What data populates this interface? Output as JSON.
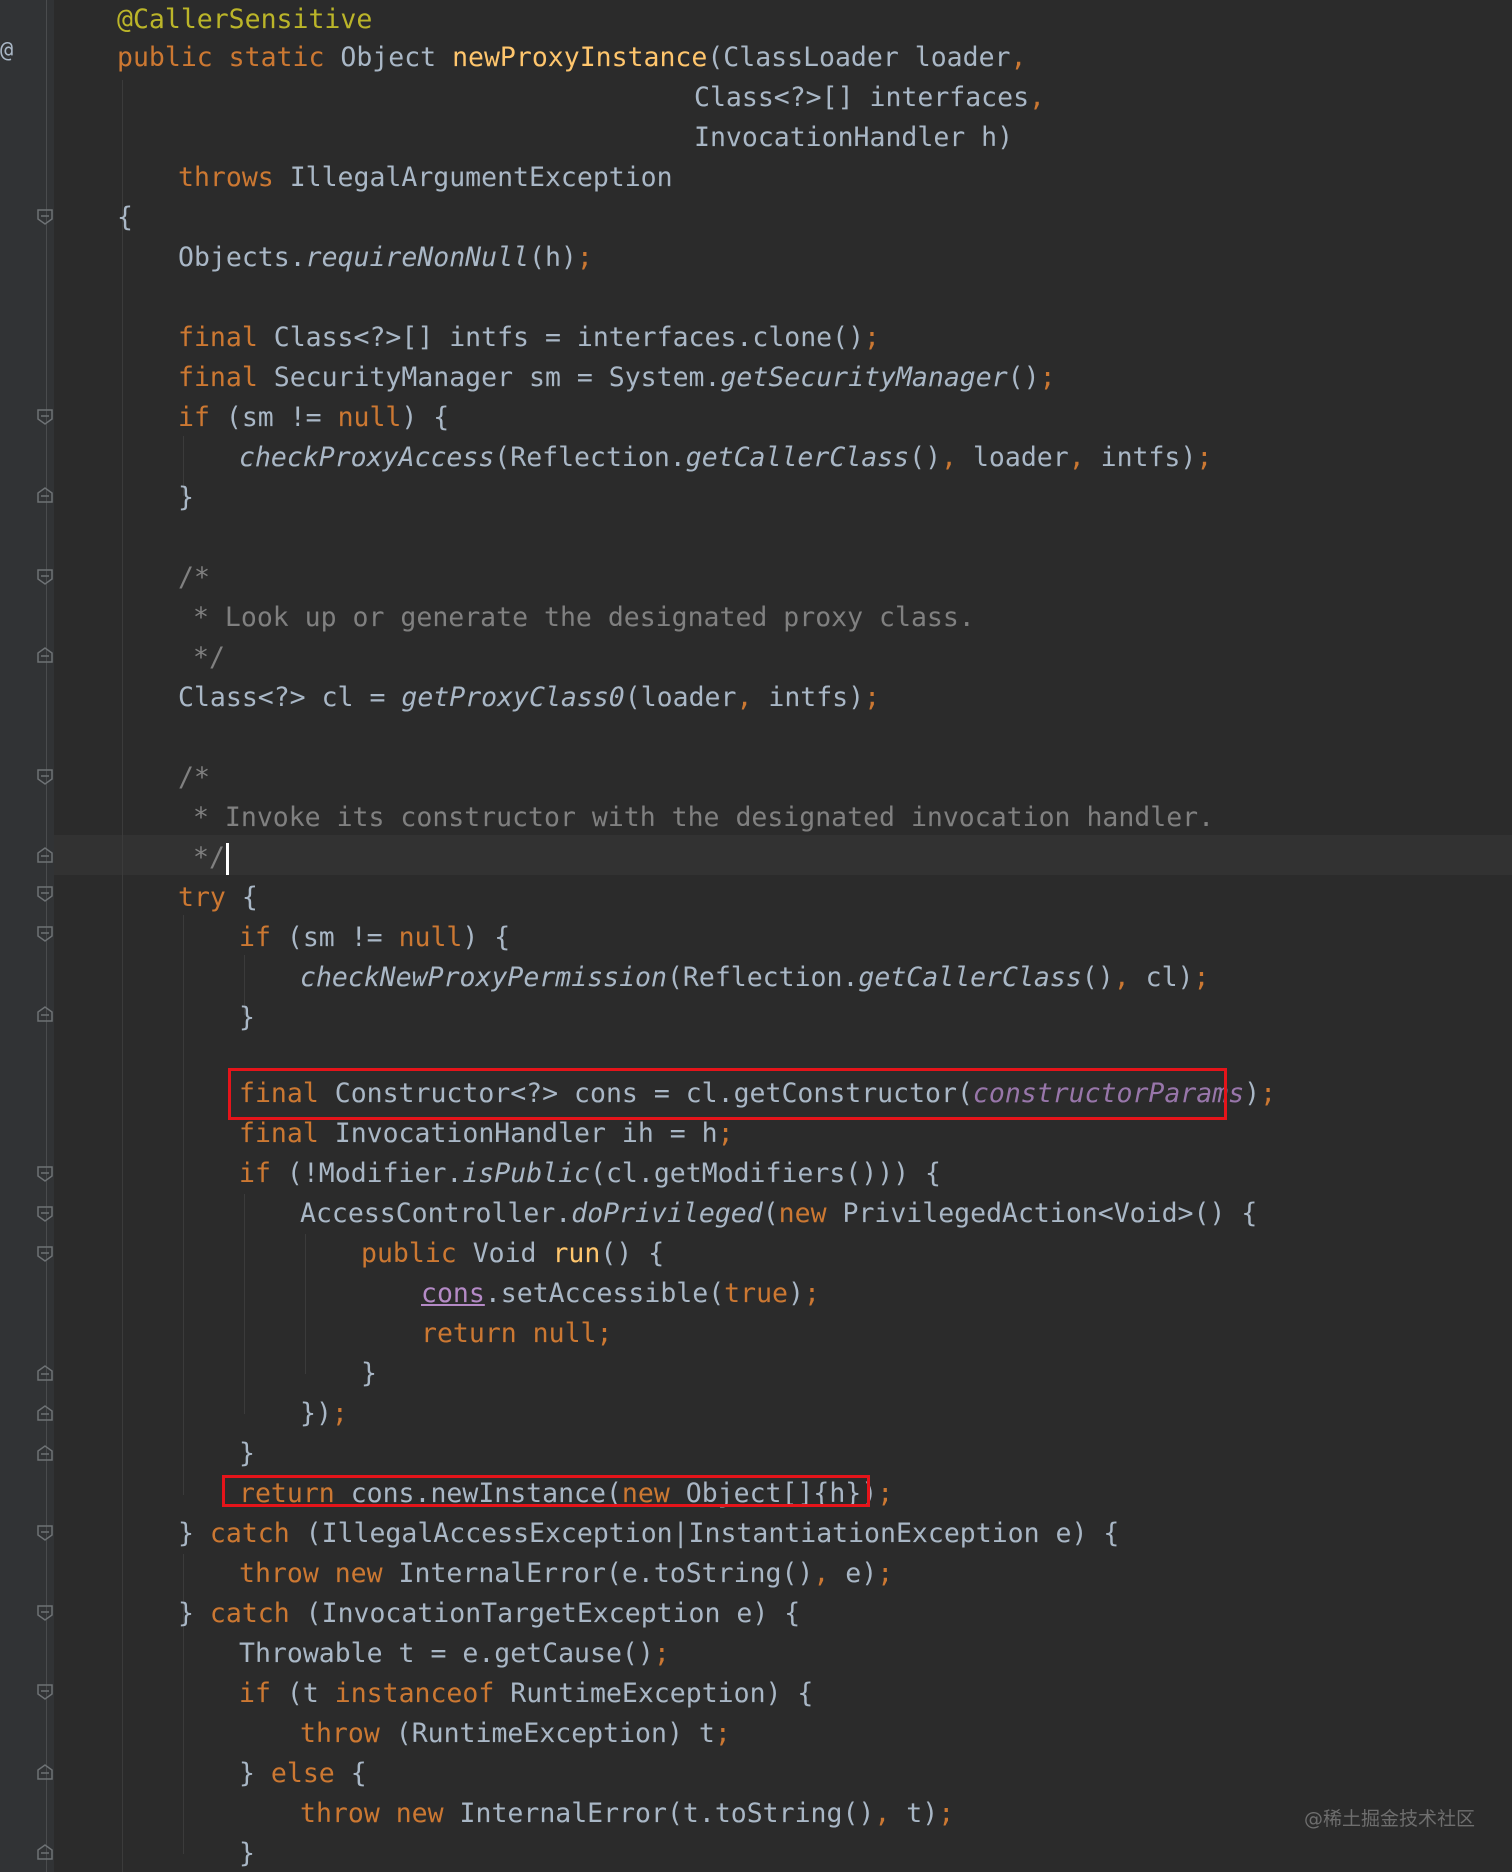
{
  "gutter": {
    "marker": "@"
  },
  "code": {
    "lines": [
      "@CallerSensitive",
      "public static Object newProxyInstance(ClassLoader loader,",
      "Class<?>[] interfaces,",
      "InvocationHandler h)",
      "throws IllegalArgumentException",
      "{",
      "Objects.requireNonNull(h);",
      "final Class<?>[] intfs = interfaces.clone();",
      "final SecurityManager sm = System.getSecurityManager();",
      "if (sm != null) {",
      "checkProxyAccess(Reflection.getCallerClass(), loader, intfs);",
      "}",
      "/*",
      "* Look up or generate the designated proxy class.",
      "*/",
      "Class<?> cl = getProxyClass0(loader, intfs);",
      "/*",
      "* Invoke its constructor with the designated invocation handler.",
      "*/",
      "try {",
      "if (sm != null) {",
      "checkNewProxyPermission(Reflection.getCallerClass(), cl);",
      "}",
      "final Constructor<?> cons = cl.getConstructor(constructorParams);",
      "final InvocationHandler ih = h;",
      "if (!Modifier.isPublic(cl.getModifiers())) {",
      "AccessController.doPrivileged(new PrivilegedAction<Void>() {",
      "public Void run() {",
      "cons.setAccessible(true);",
      "return null;",
      "}",
      "});",
      "}",
      "return cons.newInstance(new Object[]{h});",
      "} catch (IllegalAccessException|InstantiationException e) {",
      "throw new InternalError(e.toString(), e);",
      "} catch (InvocationTargetException e) {",
      "Throwable t = e.getCause();",
      "if (t instanceof RuntimeException) {",
      "throw (RuntimeException) t;",
      "} else {",
      "throw new InternalError(t.toString(), t);",
      "}"
    ],
    "highlighted_lines": [
      "final Constructor<?> cons = cl.getConstructor(constructorParams);",
      "return cons.newInstance(new Object[]{h});"
    ]
  },
  "watermark": "@稀土掘金技术社区",
  "colors": {
    "background": "#2b2b2b",
    "gutter": "#313335",
    "keyword": "#cc7832",
    "annotation": "#bbb529",
    "method_declaration": "#ffc66d",
    "comment": "#808080",
    "field": "#9876aa",
    "default_text": "#a9b7c6",
    "highlight_box": "#e5141a"
  }
}
